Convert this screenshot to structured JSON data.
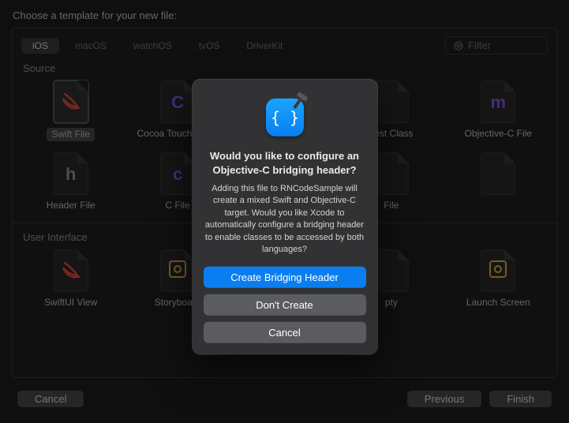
{
  "title": "Choose a template for your new file:",
  "tabs": [
    "iOS",
    "macOS",
    "watchOS",
    "tvOS",
    "DriverKit"
  ],
  "selectedTab": 0,
  "filterPlaceholder": "Filter",
  "sections": {
    "source": {
      "label": "Source",
      "row1": [
        {
          "label": "Swift File",
          "glyph": "",
          "swift": true,
          "name": "template-swift-file",
          "selected": true
        },
        {
          "label": "Cocoa Touch Class",
          "glyph": "C",
          "cls": "purple",
          "name": "template-cocoa-touch-class"
        },
        {
          "label": "",
          "glyph": "",
          "name": "template-obscured-1"
        },
        {
          "label": "Test Class",
          "glyph": "",
          "name": "template-test-class"
        },
        {
          "label": "Objective-C File",
          "glyph": "m",
          "cls": "purple",
          "name": "template-objective-c-file"
        }
      ],
      "row2": [
        {
          "label": "Header File",
          "glyph": "h",
          "cls": "gray",
          "name": "template-header-file"
        },
        {
          "label": "C File",
          "glyph": "c",
          "cls": "purple",
          "name": "template-c-file"
        },
        {
          "label": "",
          "glyph": "",
          "name": "template-obscured-2"
        },
        {
          "label": "File",
          "glyph": "",
          "name": "template-obscured-3"
        },
        {
          "label": "",
          "glyph": "",
          "name": "template-obscured-4"
        }
      ]
    },
    "ui": {
      "label": "User Interface",
      "row": [
        {
          "label": "SwiftUI View",
          "glyph": "",
          "swift": true,
          "name": "template-swiftui-view"
        },
        {
          "label": "Storyboard",
          "glyph": "",
          "cls": "yellow",
          "name": "template-storyboard",
          "story": true
        },
        {
          "label": "",
          "glyph": "",
          "name": "template-obscured-5"
        },
        {
          "label": "pty",
          "glyph": "",
          "name": "template-obscured-6"
        },
        {
          "label": "Launch Screen",
          "glyph": "",
          "cls": "yellow",
          "name": "template-launch-screen",
          "story": true
        }
      ]
    }
  },
  "footer": {
    "cancel": "Cancel",
    "previous": "Previous",
    "finish": "Finish"
  },
  "dialog": {
    "heading": "Would you like to configure an Objective-C bridging header?",
    "body": "Adding this file to RNCodeSample will create a mixed Swift and Objective-C target. Would you like Xcode to automatically configure a bridging header to enable classes to be accessed by both languages?",
    "primary": "Create Bridging Header",
    "secondary": "Don't Create",
    "cancel": "Cancel"
  }
}
